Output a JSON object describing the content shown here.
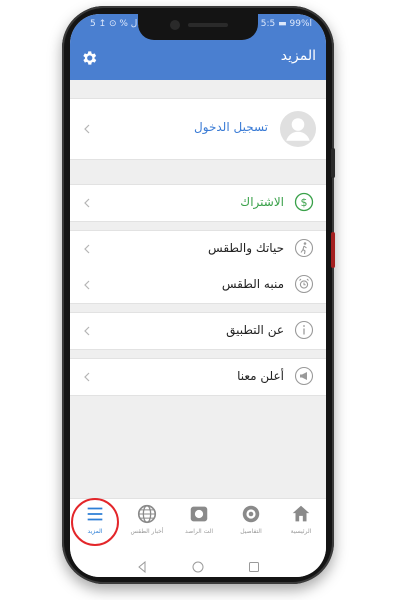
{
  "status_bar": {
    "left_text": "ال  %  ⊙  ↥  5:",
    "right_text": "ا%99  ▬  5:5"
  },
  "app_bar": {
    "title": "المزيد"
  },
  "login": {
    "label": "تسجيل الدخول",
    "color": "#3a7bd5"
  },
  "subscription": {
    "label": "الاشتراك",
    "color": "#3aa14a"
  },
  "menu_items": [
    {
      "label": "حياتك والطقس"
    },
    {
      "label": "منبه الطقس"
    },
    {
      "label": "عن التطبيق"
    },
    {
      "label": "أعلن معنا"
    }
  ],
  "bottom_nav": {
    "items": [
      {
        "label": "الرئيسية"
      },
      {
        "label": "التفاصيل"
      },
      {
        "label": "الت الراصد"
      },
      {
        "label": "أخبار الطقس"
      },
      {
        "label": "المزيد"
      }
    ],
    "active_color": "#2d7fd6",
    "inactive_color": "#9a9a9a"
  },
  "highlight_color": "#e3262a"
}
